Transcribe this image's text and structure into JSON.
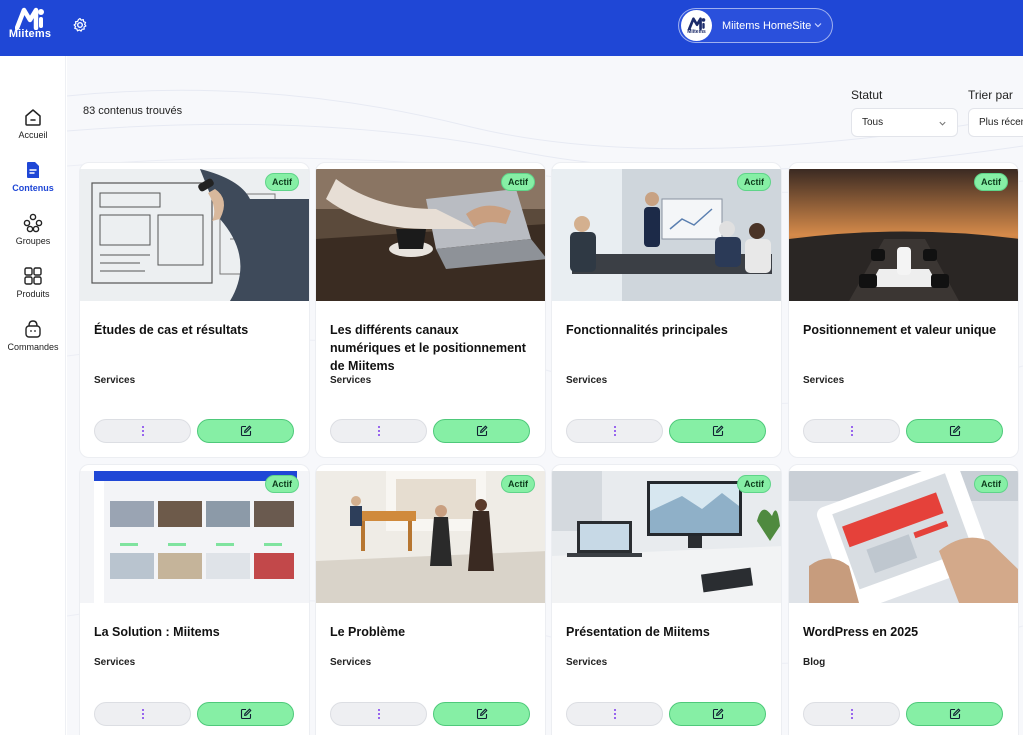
{
  "header": {
    "logo_text": "Miitems",
    "site_selector": {
      "avatar_text": "Miitems",
      "label": "Miitems HomeSite"
    }
  },
  "sidebar": {
    "items": [
      {
        "label": "Accueil",
        "icon": "home-icon",
        "active": false
      },
      {
        "label": "Contenus",
        "icon": "document-icon",
        "active": true
      },
      {
        "label": "Groupes",
        "icon": "groups-icon",
        "active": false
      },
      {
        "label": "Produits",
        "icon": "grid-icon",
        "active": false
      },
      {
        "label": "Commandes",
        "icon": "basket-icon",
        "active": false
      }
    ]
  },
  "main": {
    "result_count": "83 contenus trouvés",
    "filters": {
      "status": {
        "label": "Statut",
        "value": "Tous"
      },
      "sort": {
        "label": "Trier par",
        "value": "Plus récents"
      }
    },
    "cards": [
      {
        "title": "Études de cas et résultats",
        "category": "Services",
        "status": "Actif",
        "image": "whiteboard-sketch"
      },
      {
        "title": "Les différents canaux numériques et le positionnement de Miitems",
        "category": "Services",
        "status": "Actif",
        "image": "laptop-coffee"
      },
      {
        "title": "Fonctionnalités principales",
        "category": "Services",
        "status": "Actif",
        "image": "meeting-room"
      },
      {
        "title": "Positionnement et valeur unique",
        "category": "Services",
        "status": "Actif",
        "image": "race-car"
      },
      {
        "title": "La Solution : Miitems",
        "category": "Services",
        "status": "Actif",
        "image": "app-screenshot"
      },
      {
        "title": "Le Problème",
        "category": "Services",
        "status": "Actif",
        "image": "office-walk"
      },
      {
        "title": "Présentation de Miitems",
        "category": "Services",
        "status": "Actif",
        "image": "devices-desk"
      },
      {
        "title": "WordPress en 2025",
        "category": "Blog",
        "status": "Actif",
        "image": "online-booking-tablet"
      }
    ]
  },
  "colors": {
    "header_bg": "#1f47d6",
    "accent": "#1f47d6",
    "badge_bg": "#86efa5",
    "edit_button_bg": "#86efa5",
    "more_dots": "#7c3aed"
  }
}
